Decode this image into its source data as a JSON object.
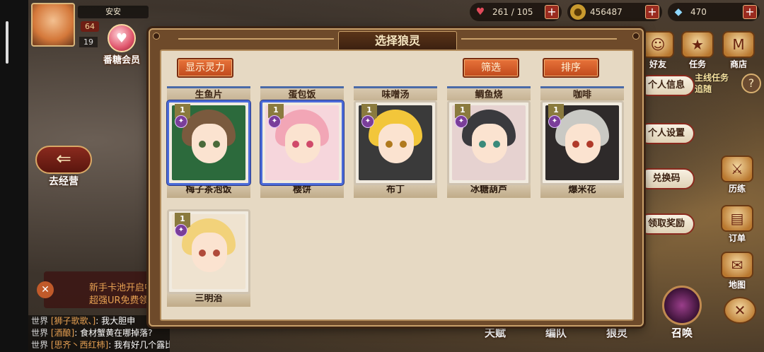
{
  "player": {
    "name": "安安",
    "level_a": "64",
    "level_b": "19",
    "vip_label": "番糖会员"
  },
  "resources": {
    "stamina": "261 / 105",
    "gold": "456487",
    "gems": "470"
  },
  "left_buttons": {
    "camp_label": "去经营"
  },
  "right_menu": {
    "friends_label": "好友",
    "mission_label": "任务",
    "shop_label": "商店",
    "profile_label": "个人信息",
    "mission_track": "主线任务",
    "mission_track_sub": "追随",
    "settings_label": "个人设置",
    "redeem_label": "兑换码",
    "claim_label": "领取奖励",
    "training_label": "历练",
    "orders_label": "订单",
    "map_label": "地图",
    "summon_label": "召唤"
  },
  "bottom_bar": {
    "talent_label": "天赋",
    "team_label": "编队",
    "spirit_label": "狼灵"
  },
  "newbie": {
    "line1": "新手卡池开启中",
    "line2": "超强UR免费领"
  },
  "chat": [
    {
      "channel": "世界",
      "name": "[狮子歌歌、]",
      "text": "我大胆申"
    },
    {
      "channel": "世界",
      "name": "[酒酿]",
      "text": "食材蟹黄在哪掉落?"
    },
    {
      "channel": "世界",
      "name": "[思齐丶西红柿]",
      "text": "我有好几个露比"
    }
  ],
  "panel": {
    "title": "选择狼灵",
    "show_power_label": "显示灵力",
    "filter_label": "筛选",
    "sort_label": "排序"
  },
  "cards": [
    {
      "top": "生鱼片",
      "name": "梅子茶泡饭",
      "level": "1",
      "selected": true,
      "hair": "#7a5a3e",
      "eyes": "#4a6a3a",
      "bg": "#2c6a3c"
    },
    {
      "top": "蛋包饭",
      "name": "樱饼",
      "level": "1",
      "selected": true,
      "hair": "#f2a6b6",
      "eyes": "#d04a6a",
      "bg": "#f6d6dc"
    },
    {
      "top": "味噌汤",
      "name": "布丁",
      "level": "1",
      "selected": false,
      "hair": "#f2c63a",
      "eyes": "#b07a1e",
      "bg": "#3a3a3a"
    },
    {
      "top": "鲷鱼烧",
      "name": "冰糖葫芦",
      "level": "1",
      "selected": false,
      "hair": "#3a3a3e",
      "eyes": "#3a8a7a",
      "bg": "#e6d2d0"
    },
    {
      "top": "咖啡",
      "name": "爆米花",
      "level": "1",
      "selected": false,
      "hair": "#c9c9c4",
      "eyes": "#b03a2a",
      "bg": "#2e2a2a"
    },
    {
      "top": "",
      "name": "三明治",
      "level": "1",
      "selected": false,
      "hair": "#f2d27a",
      "eyes": "#b04a3a",
      "bg": "#efe3d0"
    }
  ]
}
